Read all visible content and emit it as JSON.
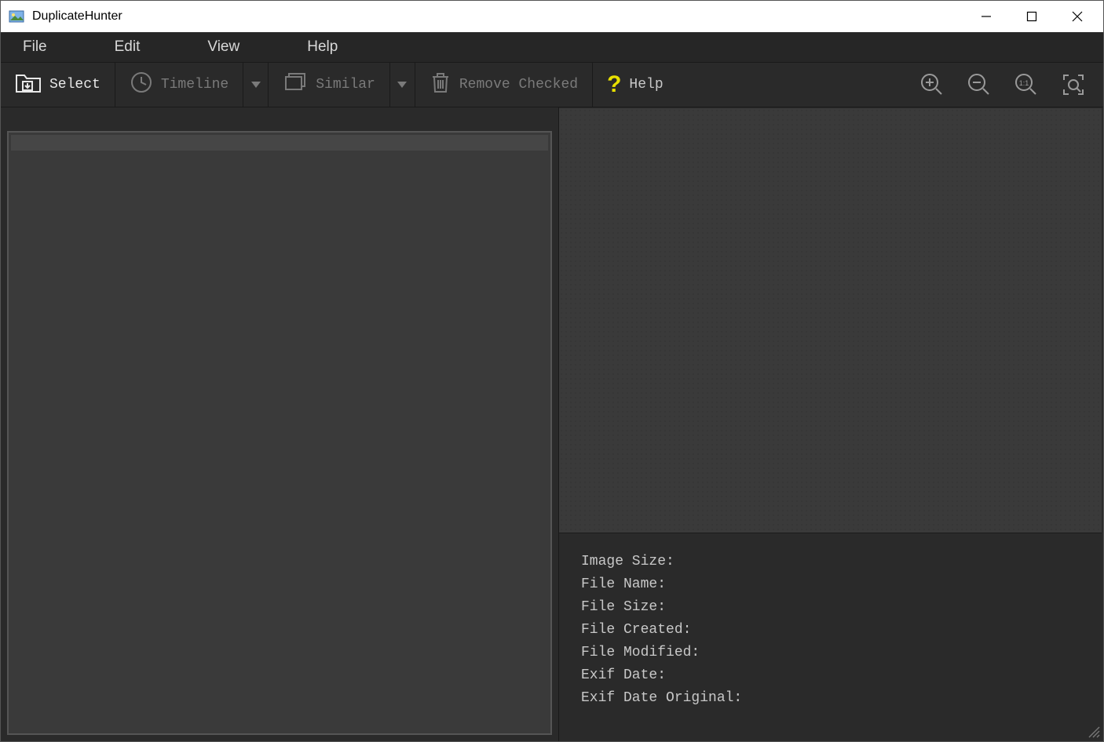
{
  "titlebar": {
    "app_name": "DuplicateHunter"
  },
  "menubar": {
    "file": "File",
    "edit": "Edit",
    "view": "View",
    "help": "Help"
  },
  "toolbar": {
    "select": "Select",
    "timeline": "Timeline",
    "similar": "Similar",
    "remove_checked": "Remove Checked",
    "help": "Help"
  },
  "info": {
    "image_size_label": "Image Size:",
    "file_name_label": "File Name:",
    "file_size_label": "File Size:",
    "file_created_label": "File Created:",
    "file_modified_label": "File Modified:",
    "exif_date_label": "Exif Date:",
    "exif_date_original_label": "Exif Date Original:",
    "image_size_value": "",
    "file_name_value": "",
    "file_size_value": "",
    "file_created_value": "",
    "file_modified_value": "",
    "exif_date_value": "",
    "exif_date_original_value": ""
  }
}
